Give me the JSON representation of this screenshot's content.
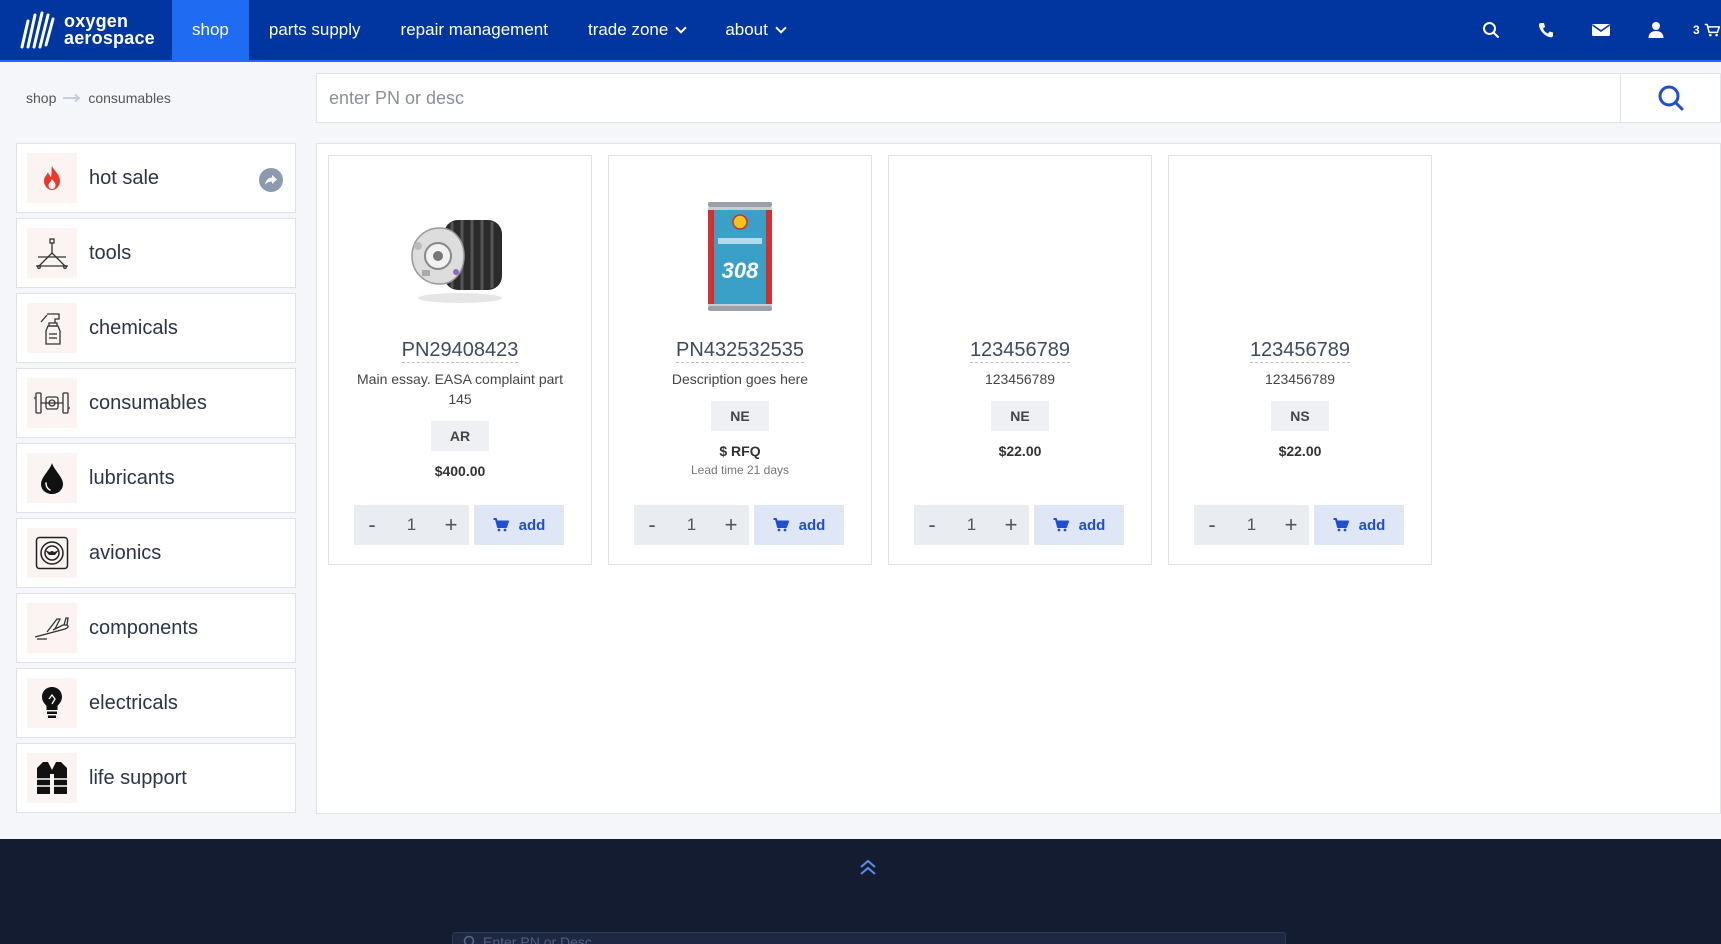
{
  "brand": {
    "line1": "oxygen",
    "line2": "aerospace"
  },
  "nav": {
    "items": [
      {
        "label": "shop",
        "active": true
      },
      {
        "label": "parts supply"
      },
      {
        "label": "repair management"
      },
      {
        "label": "trade zone",
        "dropdown": true
      },
      {
        "label": "about",
        "dropdown": true
      }
    ],
    "cart_count": "3"
  },
  "breadcrumb": {
    "items": [
      "shop",
      "consumables"
    ]
  },
  "search": {
    "placeholder": "enter PN or desc"
  },
  "sidebar": {
    "categories": [
      {
        "label": "hot sale",
        "icon": "flame-icon"
      },
      {
        "label": "tools",
        "icon": "tool-stand-icon"
      },
      {
        "label": "chemicals",
        "icon": "spray-bottle-icon"
      },
      {
        "label": "consumables",
        "icon": "piston-icon"
      },
      {
        "label": "lubricants",
        "icon": "oil-drop-icon"
      },
      {
        "label": "avionics",
        "icon": "gauge-icon"
      },
      {
        "label": "components",
        "icon": "aircraft-icon"
      },
      {
        "label": "electricals",
        "icon": "lightbulb-icon"
      },
      {
        "label": "life support",
        "icon": "life-vest-icon"
      }
    ]
  },
  "products": [
    {
      "pn": "PN29408423",
      "desc": "Main essay. EASA complaint part 145",
      "condition": "AR",
      "price": "$400.00",
      "lead": "",
      "qty": "1",
      "add_label": "add",
      "image": "alternator"
    },
    {
      "pn": "PN432532535",
      "desc": "Description goes here",
      "condition": "NE",
      "price": "$ RFQ",
      "lead": "Lead time 21 days",
      "qty": "1",
      "add_label": "add",
      "image": "oil-can"
    },
    {
      "pn": "123456789",
      "desc": "123456789",
      "condition": "NE",
      "price": "$22.00",
      "lead": "",
      "qty": "1",
      "add_label": "add",
      "image": ""
    },
    {
      "pn": "123456789",
      "desc": "123456789",
      "condition": "NS",
      "price": "$22.00",
      "lead": "",
      "qty": "1",
      "add_label": "add",
      "image": ""
    }
  ],
  "footer": {
    "search_placeholder": "Enter PN or Desc"
  },
  "colors": {
    "nav_bg": "#0136a0",
    "nav_active": "#1f6bf2",
    "accent": "#1f4fd0",
    "footer_bg": "#131c31"
  }
}
